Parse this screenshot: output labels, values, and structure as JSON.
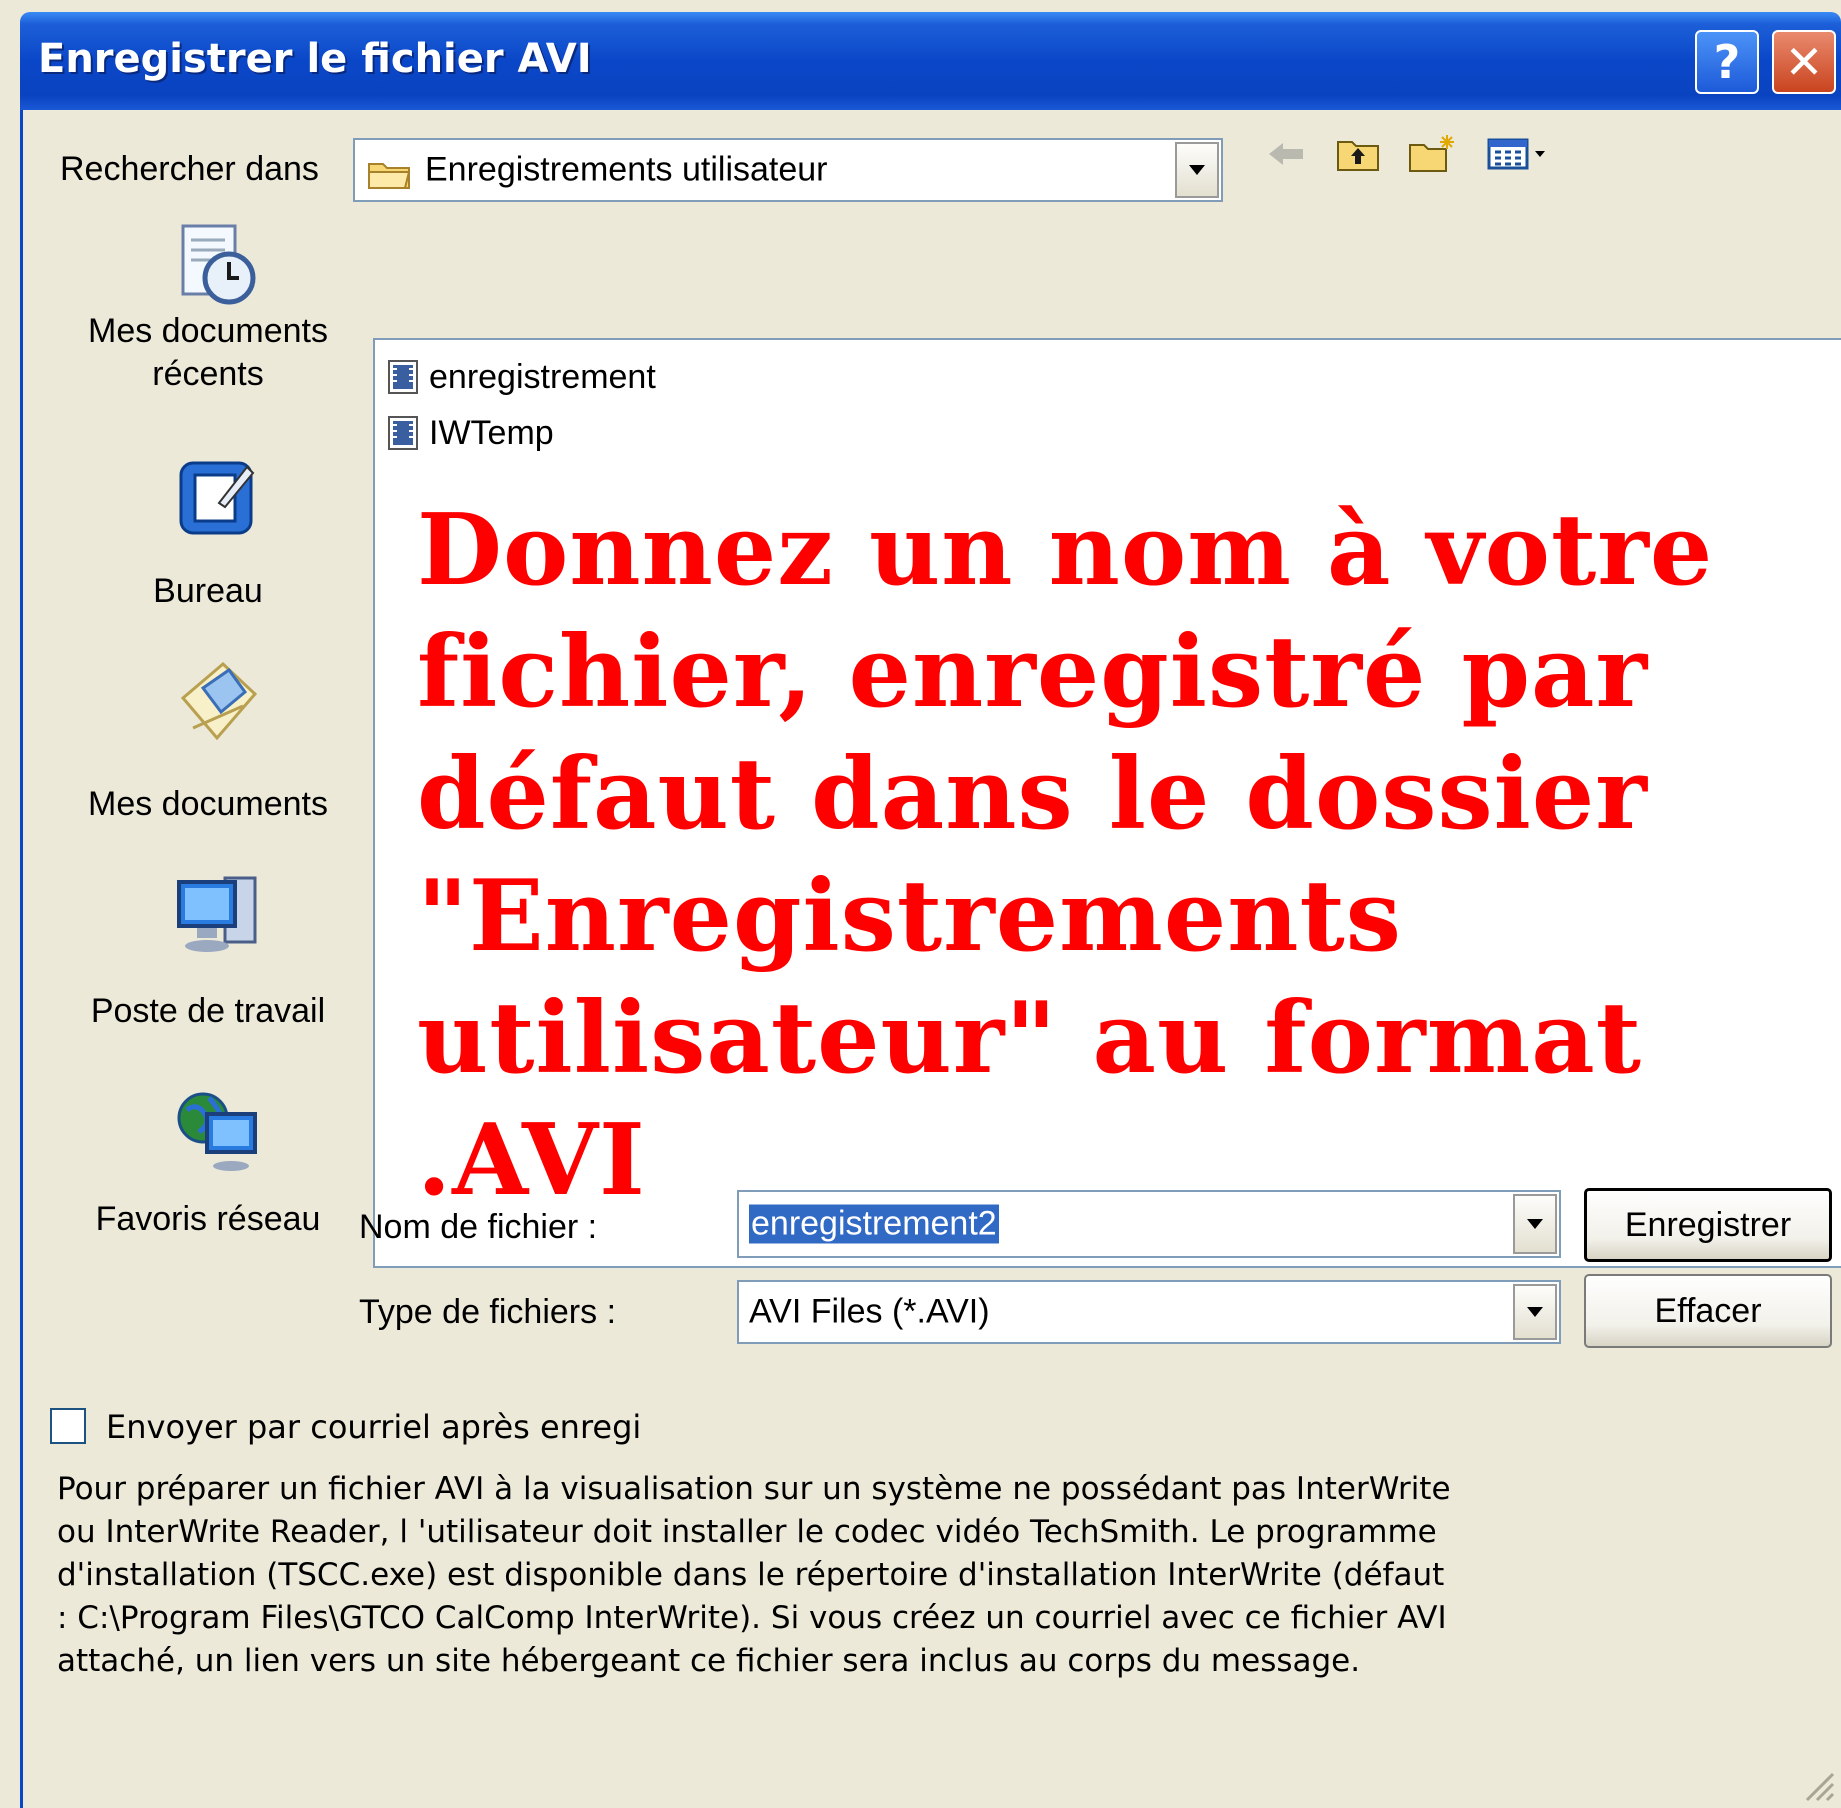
{
  "window": {
    "title": "Enregistrer le fichier AVI",
    "help_label": "?",
    "close_label": "✕"
  },
  "look_in": {
    "label": "Rechercher dans",
    "value": "Enregistrements utilisateur"
  },
  "toolbar": {
    "icons": [
      "back-arrow-icon",
      "up-folder-icon",
      "new-folder-icon",
      "view-menu-icon"
    ]
  },
  "places": [
    {
      "label": "Mes documents récents",
      "icon": "recent-documents-icon"
    },
    {
      "label": "Bureau",
      "icon": "desktop-icon"
    },
    {
      "label": "Mes documents",
      "icon": "my-documents-icon"
    },
    {
      "label": "Poste de travail",
      "icon": "my-computer-icon"
    },
    {
      "label": "Favoris réseau",
      "icon": "network-places-icon"
    }
  ],
  "files": [
    {
      "name": "enregistrement",
      "icon": "video-file-icon"
    },
    {
      "name": "IWTemp",
      "icon": "video-file-icon"
    }
  ],
  "overlay_text": "Donnez un nom à votre fichier, enregistré par défaut dans le dossier \"Enregistrements utilisateur\" au format .AVI",
  "filename": {
    "label": "Nom de fichier :",
    "value": "enregistrement2"
  },
  "filetype": {
    "label": "Type de fichiers :",
    "value": "AVI Files (*.AVI)"
  },
  "buttons": {
    "save": "Enregistrer",
    "cancel": "Effacer"
  },
  "email_checkbox": {
    "label": "Envoyer par courriel après enregi",
    "checked": false
  },
  "info_text": "Pour préparer un fichier AVI à la visualisation sur un système ne possédant pas InterWrite ou InterWrite Reader, l 'utilisateur doit installer le codec vidéo TechSmith. Le programme d'installation (TSCC.exe) est disponible dans le répertoire d'installation InterWrite (défaut : C:\\Program Files\\GTCO CalComp InterWrite). Si vous créez un courriel avec ce fichier AVI attaché, un lien vers un site hébergeant ce fichier sera inclus au corps du message.",
  "colors": {
    "titlebar": "#0a47c8",
    "dialog_bg": "#ece9d8",
    "overlay_text": "#ff0000",
    "selection": "#316ac5"
  }
}
